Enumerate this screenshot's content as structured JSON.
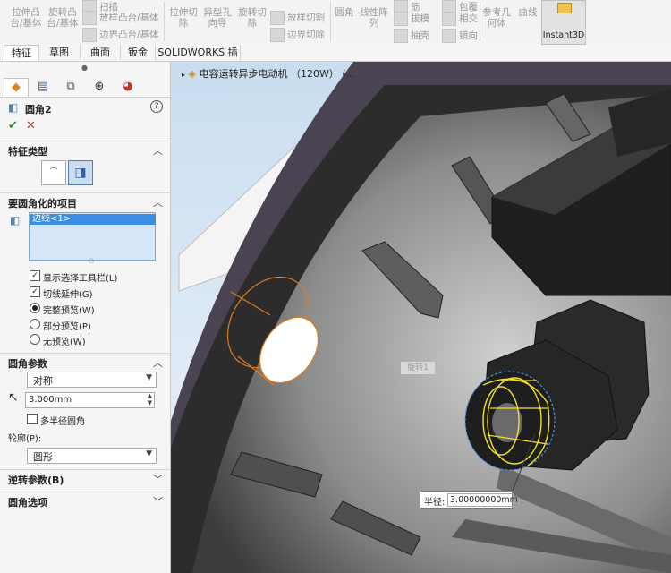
{
  "ribbon": {
    "extrude_boss": "拉伸凸\n台/基体",
    "revolve_boss": "旋转凸\n台/基体",
    "sweep_boss": "扫描",
    "loft_boss": "放样凸台/基体",
    "boundary_boss": "边界凸台/基体",
    "extrude_cut": "拉伸切\n除",
    "hole_wizard": "异型孔\n向导",
    "revolve_cut": "旋转切\n除",
    "loft_cut": "放样切割",
    "boundary_cut": "边界切除",
    "fillet": "圆角",
    "linear_pattern": "线性阵\n列",
    "rib": "筋",
    "draft": "拔模",
    "shell": "抽壳",
    "wrap": "包覆",
    "intersect": "相交",
    "mirror": "镜向",
    "ref_geometry": "参考几\n何体",
    "curves": "曲线",
    "instant3d": "Instant3D"
  },
  "tabs": [
    {
      "label": "特征",
      "active": true
    },
    {
      "label": "草图",
      "active": false
    },
    {
      "label": "曲面",
      "active": false
    },
    {
      "label": "钣金",
      "active": false
    },
    {
      "label": "SOLIDWORKS 插件",
      "active": false
    }
  ],
  "panel": {
    "title": "圆角2",
    "ok_label": "✔",
    "cancel_label": "✕",
    "help_label": "?",
    "feature_type_header": "特征类型",
    "items_header": "要圆角化的项目",
    "selected_item": "边线<1>",
    "show_toolbar": "显示选择工具栏(L)",
    "tangent_propagation": "切线延伸(G)",
    "full_preview": "完整预览(W)",
    "partial_preview": "部分预览(P)",
    "no_preview": "无预览(W)",
    "params_header": "圆角参数",
    "symmetric": "对称",
    "radius": "3.000mm",
    "multi_radius": "多半径圆角",
    "profile_label": "轮廓(P):",
    "profile_value": "圆形",
    "reverse_header": "逆转参数(B)",
    "options_header": "圆角选项"
  },
  "viewport": {
    "tree_item": "电容运转异步电动机 （120W）  (...",
    "tooltip": "旋转1",
    "radius_label": "半径:",
    "radius_value": "3.00000000mm"
  }
}
